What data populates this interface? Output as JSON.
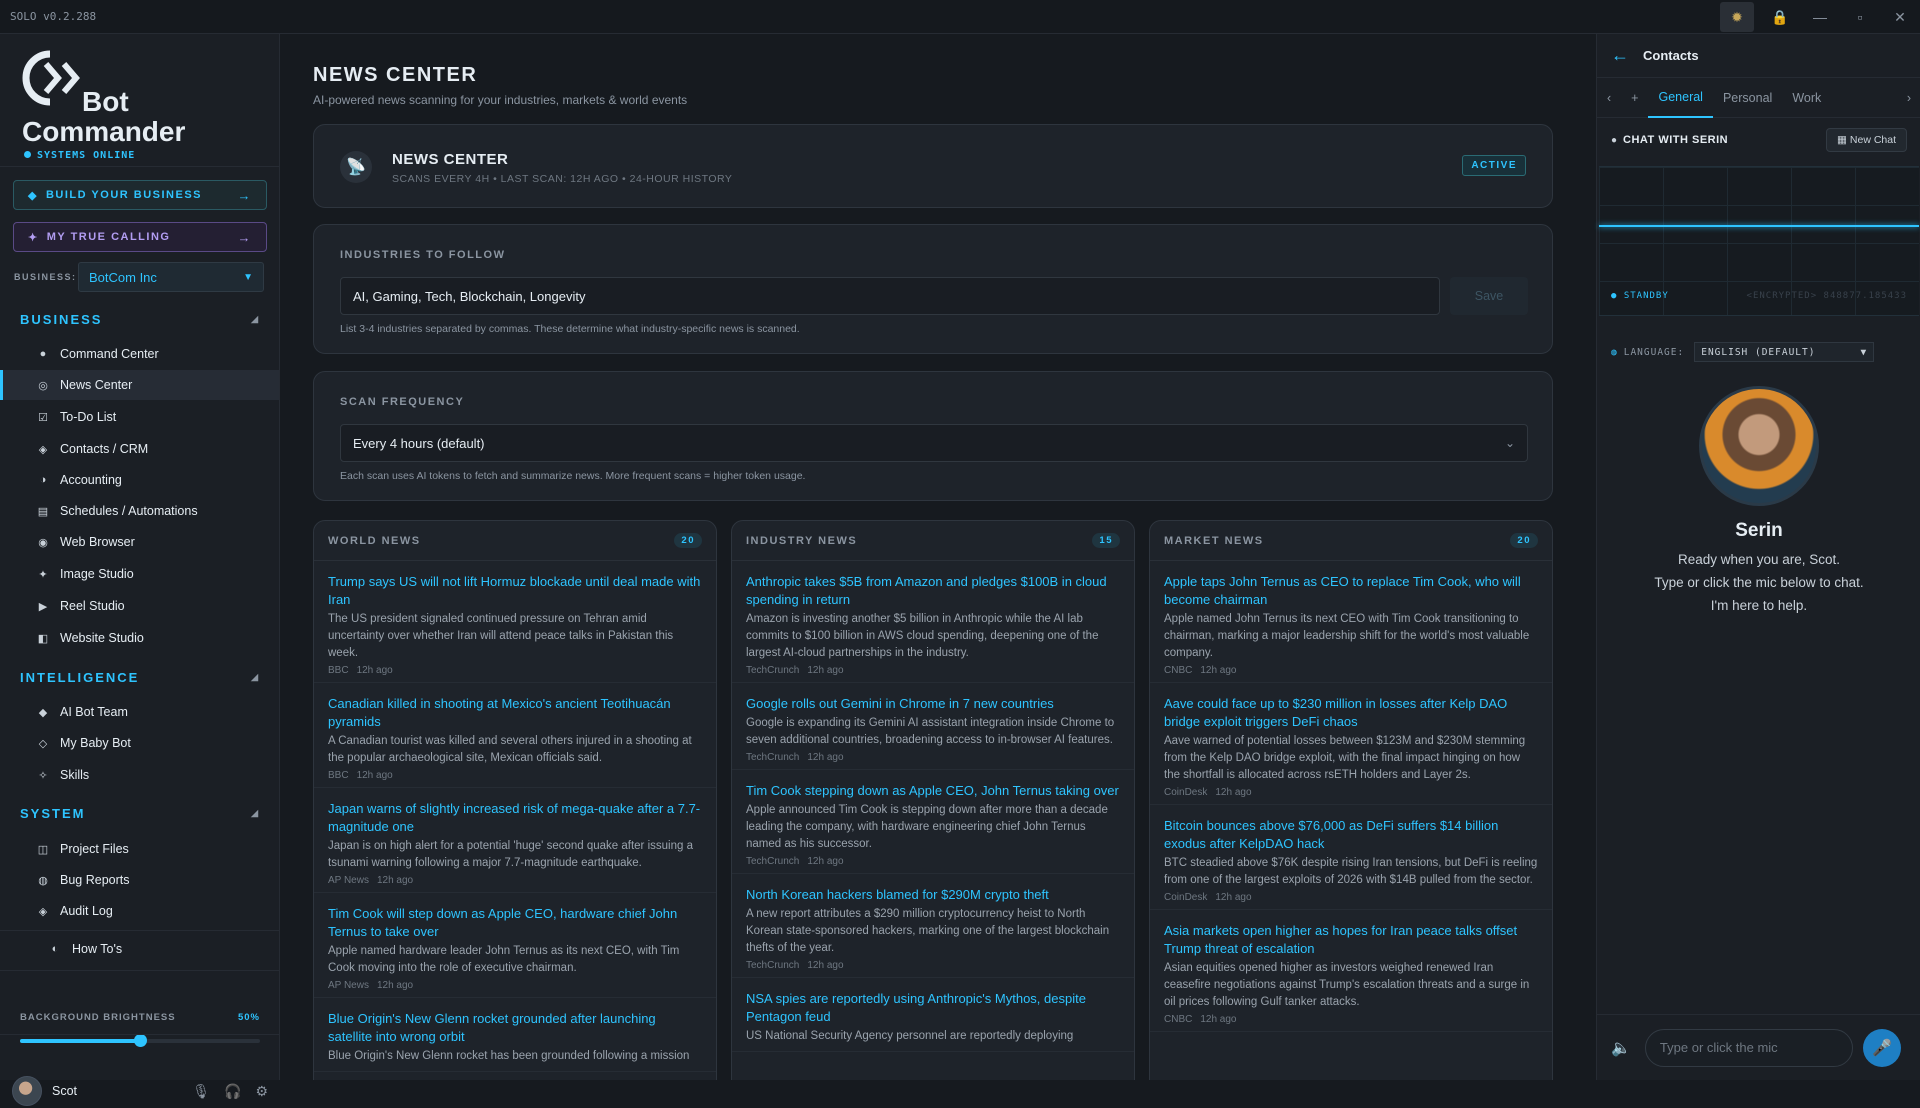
{
  "titlebar": {
    "version": "SOLO  v0.2.288"
  },
  "sidebar": {
    "logo_line1": "Bot",
    "logo_line2": "Commander",
    "status": "SYSTEMS ONLINE",
    "cta_build": "BUILD YOUR BUSINESS",
    "cta_calling": "MY TRUE CALLING",
    "business_label": "BUSINESS:",
    "business_value": "BotCom Inc",
    "sections": {
      "business": "BUSINESS",
      "intelligence": "INTELLIGENCE",
      "system": "SYSTEM"
    },
    "items": {
      "command_center": "Command Center",
      "news_center": "News Center",
      "todo": "To-Do List",
      "contacts": "Contacts / CRM",
      "accounting": "Accounting",
      "schedules": "Schedules / Automations",
      "web_browser": "Web Browser",
      "image_studio": "Image Studio",
      "reel_studio": "Reel Studio",
      "website_studio": "Website Studio",
      "ai_bot_team": "AI Bot Team",
      "my_baby_bot": "My Baby Bot",
      "skills": "Skills",
      "project_files": "Project Files",
      "bug_reports": "Bug Reports",
      "audit_log": "Audit Log",
      "how_tos": "How To's"
    },
    "brightness_label": "BACKGROUND BRIGHTNESS",
    "brightness_value": "50%",
    "brightness_fraction": 0.5,
    "user_name": "Scot"
  },
  "main": {
    "title": "NEWS CENTER",
    "subtitle": "AI-powered news scanning for your industries, markets & world events",
    "hero_title": "NEWS CENTER",
    "hero_meta": "SCANS EVERY 4H • LAST SCAN: 12H AGO • 24-HOUR HISTORY",
    "hero_badge": "ACTIVE",
    "industries_label": "INDUSTRIES TO FOLLOW",
    "industries_value": "AI, Gaming, Tech, Blockchain, Longevity",
    "save_label": "Save",
    "industries_help": "List 3-4 industries separated by commas. These determine what industry-specific news is scanned.",
    "scan_label": "SCAN FREQUENCY",
    "scan_value": "Every 4 hours (default)",
    "scan_help": "Each scan uses AI tokens to fetch and summarize news. More frequent scans = higher token usage.",
    "columns": [
      {
        "title": "WORLD NEWS",
        "count": "20",
        "items": [
          {
            "title": "Trump says US will not lift Hormuz blockade until deal made with Iran",
            "desc": "The US president signaled continued pressure on Tehran amid uncertainty over whether Iran will attend peace talks in Pakistan this week.",
            "source": "BBC",
            "time": "12h ago"
          },
          {
            "title": "Canadian killed in shooting at Mexico's ancient Teotihuacán pyramids",
            "desc": "A Canadian tourist was killed and several others injured in a shooting at the popular archaeological site, Mexican officials said.",
            "source": "BBC",
            "time": "12h ago"
          },
          {
            "title": "Japan warns of slightly increased risk of mega-quake after a 7.7-magnitude one",
            "desc": "Japan is on high alert for a potential 'huge' second quake after issuing a tsunami warning following a major 7.7-magnitude earthquake.",
            "source": "AP News",
            "time": "12h ago"
          },
          {
            "title": "Tim Cook will step down as Apple CEO, hardware chief John Ternus to take over",
            "desc": "Apple named hardware leader John Ternus as its next CEO, with Tim Cook moving into the role of executive chairman.",
            "source": "AP News",
            "time": "12h ago"
          },
          {
            "title": "Blue Origin's New Glenn rocket grounded after launching satellite into wrong orbit",
            "desc": "Blue Origin's New Glenn rocket has been grounded following a mission",
            "source": "",
            "time": ""
          }
        ]
      },
      {
        "title": "INDUSTRY NEWS",
        "count": "15",
        "items": [
          {
            "title": "Anthropic takes $5B from Amazon and pledges $100B in cloud spending in return",
            "desc": "Amazon is investing another $5 billion in Anthropic while the AI lab commits to $100 billion in AWS cloud spending, deepening one of the largest AI-cloud partnerships in the industry.",
            "source": "TechCrunch",
            "time": "12h ago"
          },
          {
            "title": "Google rolls out Gemini in Chrome in 7 new countries",
            "desc": "Google is expanding its Gemini AI assistant integration inside Chrome to seven additional countries, broadening access to in-browser AI features.",
            "source": "TechCrunch",
            "time": "12h ago"
          },
          {
            "title": "Tim Cook stepping down as Apple CEO, John Ternus taking over",
            "desc": "Apple announced Tim Cook is stepping down after more than a decade leading the company, with hardware engineering chief John Ternus named as his successor.",
            "source": "TechCrunch",
            "time": "12h ago"
          },
          {
            "title": "North Korean hackers blamed for $290M crypto theft",
            "desc": "A new report attributes a $290 million cryptocurrency heist to North Korean state-sponsored hackers, marking one of the largest blockchain thefts of the year.",
            "source": "TechCrunch",
            "time": "12h ago"
          },
          {
            "title": "NSA spies are reportedly using Anthropic's Mythos, despite Pentagon feud",
            "desc": "US National Security Agency personnel are reportedly deploying",
            "source": "",
            "time": ""
          }
        ]
      },
      {
        "title": "MARKET NEWS",
        "count": "20",
        "items": [
          {
            "title": "Apple taps John Ternus as CEO to replace Tim Cook, who will become chairman",
            "desc": "Apple named John Ternus its next CEO with Tim Cook transitioning to chairman, marking a major leadership shift for the world's most valuable company.",
            "source": "CNBC",
            "time": "12h ago"
          },
          {
            "title": "Aave could face up to $230 million in losses after Kelp DAO bridge exploit triggers DeFi chaos",
            "desc": "Aave warned of potential losses between $123M and $230M stemming from the Kelp DAO bridge exploit, with the final impact hinging on how the shortfall is allocated across rsETH holders and Layer 2s.",
            "source": "CoinDesk",
            "time": "12h ago"
          },
          {
            "title": "Bitcoin bounces above $76,000 as DeFi suffers $14 billion exodus after KelpDAO hack",
            "desc": "BTC steadied above $76K despite rising Iran tensions, but DeFi is reeling from one of the largest exploits of 2026 with $14B pulled from the sector.",
            "source": "CoinDesk",
            "time": "12h ago"
          },
          {
            "title": "Asia markets open higher as hopes for Iran peace talks offset Trump threat of escalation",
            "desc": "Asian equities opened higher as investors weighed renewed Iran ceasefire negotiations against Trump's escalation threats and a surge in oil prices following Gulf tanker attacks.",
            "source": "CNBC",
            "time": "12h ago"
          }
        ]
      }
    ]
  },
  "right": {
    "title": "Contacts",
    "tabs": [
      "General",
      "Personal",
      "Work"
    ],
    "chat_title": "CHAT WITH SERIN",
    "new_chat": "New Chat",
    "standby": "STANDBY",
    "encrypted": "<ENCRYPTED> 848877.185433",
    "language_label": "LANGUAGE:",
    "language_value": "ENGLISH (DEFAULT)",
    "assistant_name": "Serin",
    "greeting_1": "Ready when you are, Scot.",
    "greeting_2": "Type or click the mic below to chat.",
    "greeting_3": "I'm here to help.",
    "input_placeholder": "Type or click the mic"
  }
}
